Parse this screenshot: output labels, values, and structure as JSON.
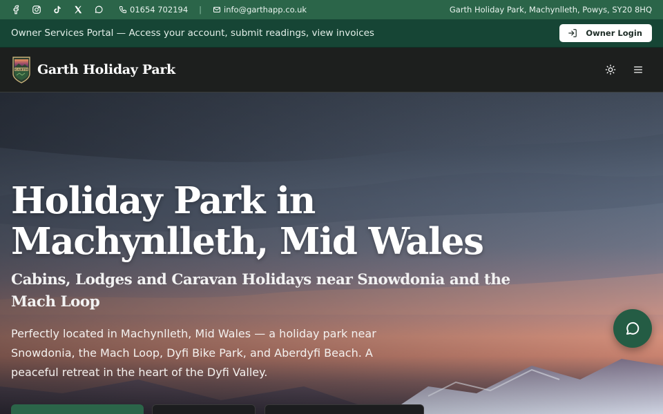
{
  "topbar": {
    "socials": [
      {
        "icon": "facebook-icon"
      },
      {
        "icon": "instagram-icon"
      },
      {
        "icon": "tiktok-icon"
      },
      {
        "icon": "x-icon"
      },
      {
        "icon": "chat-bubble-icon"
      }
    ],
    "phone": "01654 702194",
    "email": "info@garthapp.co.uk",
    "separator": "|",
    "address": "Garth Holiday Park, Machynlleth, Powys, SY20 8HQ"
  },
  "portal": {
    "text": "Owner Services Portal — Access your account, submit readings, view invoices",
    "login_label": "Owner Login"
  },
  "nav": {
    "logo_text": "GARTH",
    "brand": "Garth Holiday Park",
    "theme_icon": "sun-icon",
    "menu_icon": "hamburger-menu-icon"
  },
  "hero": {
    "title": "Holiday Park in Machynlleth, Mid Wales",
    "subtitle": "Cabins, Lodges and Caravan Holidays near Snowdonia and the Mach Loop",
    "description": "Perfectly located in Machynlleth, Mid Wales — a holiday park near Snowdonia, the Mach Loop, Dyfi Bike Park, and Aberdyfi Beach. A peaceful retreat in the heart of the Dyfi Valley."
  },
  "colors": {
    "brand_green": "#2b6549",
    "portal_green": "#164535",
    "nav_dark": "#1d1f1e",
    "fab_green": "#245c44"
  }
}
